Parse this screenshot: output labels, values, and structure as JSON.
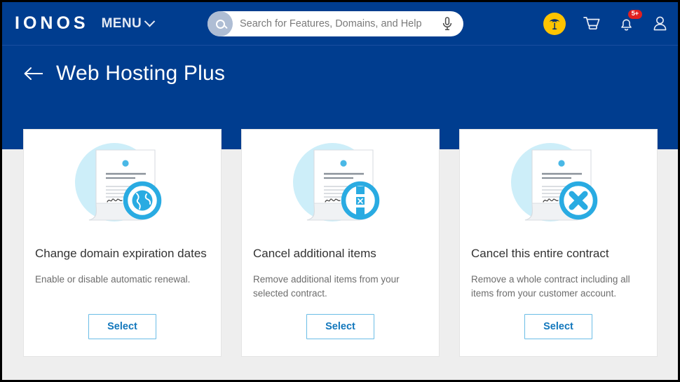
{
  "brand": {
    "logo": "IONOS",
    "menu_label": "MENU",
    "menu_icon": "chevron-down-icon"
  },
  "search": {
    "placeholder": "Search for Features, Domains, and Help",
    "value": "",
    "icon": "search-icon",
    "voice_icon": "microphone-icon"
  },
  "nav_icons": {
    "promo": {
      "name": "palm-tree-icon",
      "bg": "#ffc400"
    },
    "cart": {
      "name": "shopping-cart-icon"
    },
    "notifications": {
      "name": "bell-icon",
      "badge": "5+",
      "badge_color": "#e02020"
    },
    "account": {
      "name": "user-account-icon"
    }
  },
  "page": {
    "back_icon": "back-arrow-icon",
    "title": "Web Hosting Plus",
    "header_color": "#003d8f",
    "background": "#eeeeee"
  },
  "cards": [
    {
      "illustration": "contract-globe-icon",
      "title": "Change domain expiration dates",
      "description": "Enable or disable automatic renewal.",
      "button_label": "Select"
    },
    {
      "illustration": "contract-items-cancel-icon",
      "title": "Cancel additional items",
      "description": "Remove additional items from your selected contract.",
      "button_label": "Select"
    },
    {
      "illustration": "contract-cancel-icon",
      "title": "Cancel this entire contract",
      "description": "Remove a whole contract including all items from your customer account.",
      "button_label": "Select"
    }
  ],
  "colors": {
    "primary_blue": "#003d8f",
    "accent_cyan": "#29abe2",
    "link_blue": "#1277bc",
    "button_border": "#6bbde6"
  }
}
